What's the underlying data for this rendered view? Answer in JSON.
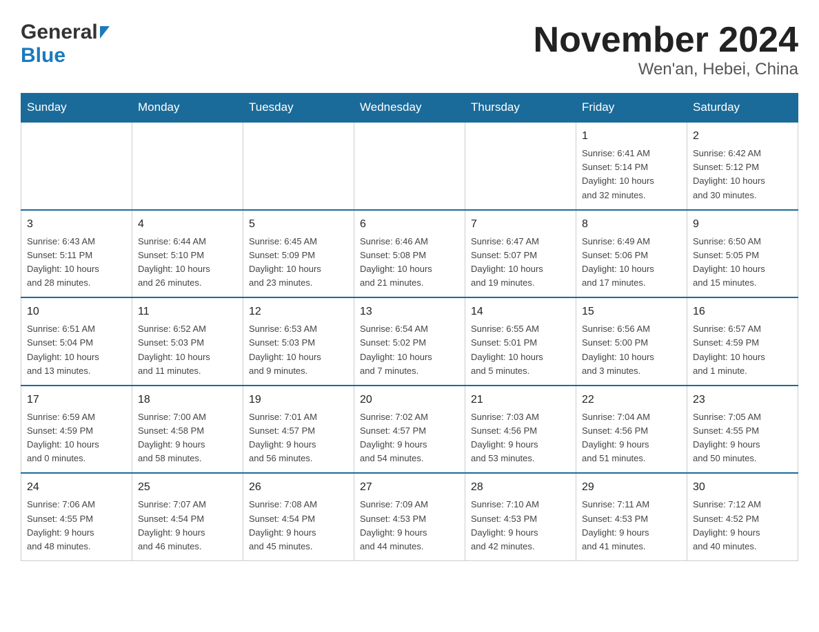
{
  "header": {
    "title": "November 2024",
    "subtitle": "Wen'an, Hebei, China",
    "logo_general": "General",
    "logo_blue": "Blue"
  },
  "days_of_week": [
    "Sunday",
    "Monday",
    "Tuesday",
    "Wednesday",
    "Thursday",
    "Friday",
    "Saturday"
  ],
  "weeks": [
    {
      "days": [
        {
          "number": "",
          "info": ""
        },
        {
          "number": "",
          "info": ""
        },
        {
          "number": "",
          "info": ""
        },
        {
          "number": "",
          "info": ""
        },
        {
          "number": "",
          "info": ""
        },
        {
          "number": "1",
          "info": "Sunrise: 6:41 AM\nSunset: 5:14 PM\nDaylight: 10 hours\nand 32 minutes."
        },
        {
          "number": "2",
          "info": "Sunrise: 6:42 AM\nSunset: 5:12 PM\nDaylight: 10 hours\nand 30 minutes."
        }
      ]
    },
    {
      "days": [
        {
          "number": "3",
          "info": "Sunrise: 6:43 AM\nSunset: 5:11 PM\nDaylight: 10 hours\nand 28 minutes."
        },
        {
          "number": "4",
          "info": "Sunrise: 6:44 AM\nSunset: 5:10 PM\nDaylight: 10 hours\nand 26 minutes."
        },
        {
          "number": "5",
          "info": "Sunrise: 6:45 AM\nSunset: 5:09 PM\nDaylight: 10 hours\nand 23 minutes."
        },
        {
          "number": "6",
          "info": "Sunrise: 6:46 AM\nSunset: 5:08 PM\nDaylight: 10 hours\nand 21 minutes."
        },
        {
          "number": "7",
          "info": "Sunrise: 6:47 AM\nSunset: 5:07 PM\nDaylight: 10 hours\nand 19 minutes."
        },
        {
          "number": "8",
          "info": "Sunrise: 6:49 AM\nSunset: 5:06 PM\nDaylight: 10 hours\nand 17 minutes."
        },
        {
          "number": "9",
          "info": "Sunrise: 6:50 AM\nSunset: 5:05 PM\nDaylight: 10 hours\nand 15 minutes."
        }
      ]
    },
    {
      "days": [
        {
          "number": "10",
          "info": "Sunrise: 6:51 AM\nSunset: 5:04 PM\nDaylight: 10 hours\nand 13 minutes."
        },
        {
          "number": "11",
          "info": "Sunrise: 6:52 AM\nSunset: 5:03 PM\nDaylight: 10 hours\nand 11 minutes."
        },
        {
          "number": "12",
          "info": "Sunrise: 6:53 AM\nSunset: 5:03 PM\nDaylight: 10 hours\nand 9 minutes."
        },
        {
          "number": "13",
          "info": "Sunrise: 6:54 AM\nSunset: 5:02 PM\nDaylight: 10 hours\nand 7 minutes."
        },
        {
          "number": "14",
          "info": "Sunrise: 6:55 AM\nSunset: 5:01 PM\nDaylight: 10 hours\nand 5 minutes."
        },
        {
          "number": "15",
          "info": "Sunrise: 6:56 AM\nSunset: 5:00 PM\nDaylight: 10 hours\nand 3 minutes."
        },
        {
          "number": "16",
          "info": "Sunrise: 6:57 AM\nSunset: 4:59 PM\nDaylight: 10 hours\nand 1 minute."
        }
      ]
    },
    {
      "days": [
        {
          "number": "17",
          "info": "Sunrise: 6:59 AM\nSunset: 4:59 PM\nDaylight: 10 hours\nand 0 minutes."
        },
        {
          "number": "18",
          "info": "Sunrise: 7:00 AM\nSunset: 4:58 PM\nDaylight: 9 hours\nand 58 minutes."
        },
        {
          "number": "19",
          "info": "Sunrise: 7:01 AM\nSunset: 4:57 PM\nDaylight: 9 hours\nand 56 minutes."
        },
        {
          "number": "20",
          "info": "Sunrise: 7:02 AM\nSunset: 4:57 PM\nDaylight: 9 hours\nand 54 minutes."
        },
        {
          "number": "21",
          "info": "Sunrise: 7:03 AM\nSunset: 4:56 PM\nDaylight: 9 hours\nand 53 minutes."
        },
        {
          "number": "22",
          "info": "Sunrise: 7:04 AM\nSunset: 4:56 PM\nDaylight: 9 hours\nand 51 minutes."
        },
        {
          "number": "23",
          "info": "Sunrise: 7:05 AM\nSunset: 4:55 PM\nDaylight: 9 hours\nand 50 minutes."
        }
      ]
    },
    {
      "days": [
        {
          "number": "24",
          "info": "Sunrise: 7:06 AM\nSunset: 4:55 PM\nDaylight: 9 hours\nand 48 minutes."
        },
        {
          "number": "25",
          "info": "Sunrise: 7:07 AM\nSunset: 4:54 PM\nDaylight: 9 hours\nand 46 minutes."
        },
        {
          "number": "26",
          "info": "Sunrise: 7:08 AM\nSunset: 4:54 PM\nDaylight: 9 hours\nand 45 minutes."
        },
        {
          "number": "27",
          "info": "Sunrise: 7:09 AM\nSunset: 4:53 PM\nDaylight: 9 hours\nand 44 minutes."
        },
        {
          "number": "28",
          "info": "Sunrise: 7:10 AM\nSunset: 4:53 PM\nDaylight: 9 hours\nand 42 minutes."
        },
        {
          "number": "29",
          "info": "Sunrise: 7:11 AM\nSunset: 4:53 PM\nDaylight: 9 hours\nand 41 minutes."
        },
        {
          "number": "30",
          "info": "Sunrise: 7:12 AM\nSunset: 4:52 PM\nDaylight: 9 hours\nand 40 minutes."
        }
      ]
    }
  ]
}
